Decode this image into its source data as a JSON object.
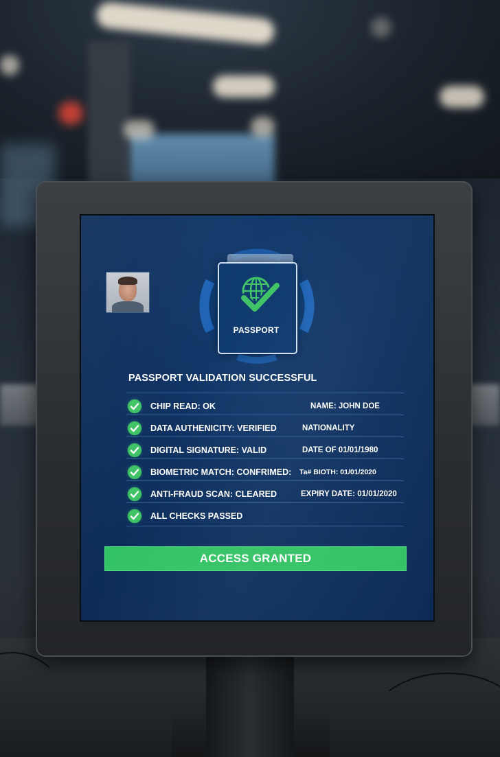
{
  "screen": {
    "title": "PASSPORT VALIDATION SUCCESSFUL",
    "emblem_label": "PASSPORT",
    "checks": [
      {
        "label": "CHIP READ: OK",
        "status": "check-icon"
      },
      {
        "label": "DATA AUTHENICITY: VERIFIED",
        "status": "check-icon"
      },
      {
        "label": "DIGITAL SIGNATURE: VALID",
        "status": "check-icon"
      },
      {
        "label": "BIOMETRIC MATCH: CONFRIMED:",
        "status": "check-icon"
      },
      {
        "label": "ANTI-FRAUD SCAN: CLEARED",
        "status": "check-icon"
      },
      {
        "label": "ALL CHECKS PASSED",
        "status": "check-icon"
      }
    ],
    "info": [
      "NAME: JOHN DOE",
      "NATIONALITY",
      "DATE OF 01/01/1980",
      "Ta# BIOTH: 01/01/2020",
      "EXPIRY DATE: 01/01/2020"
    ],
    "access_button": "ACCESS GRANTED"
  },
  "colors": {
    "screen_background": "#0f3262",
    "success_green": "#33c264",
    "text": "#ffffff"
  },
  "icons": [
    "globe-icon",
    "check-icon",
    "passport-icon"
  ]
}
